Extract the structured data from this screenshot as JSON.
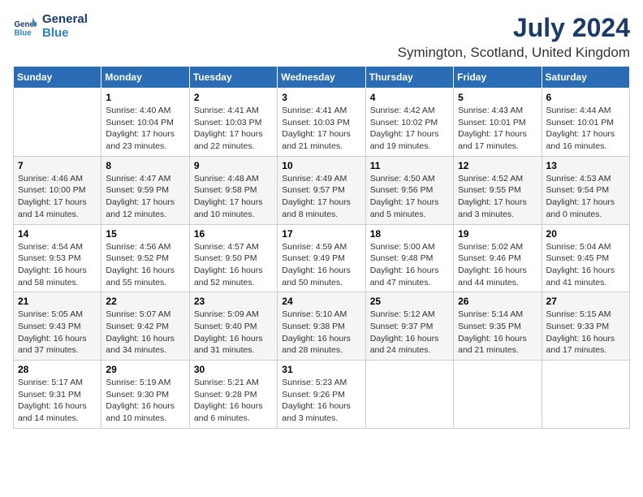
{
  "header": {
    "logo_line1": "General",
    "logo_line2": "Blue",
    "title": "July 2024",
    "subtitle": "Symington, Scotland, United Kingdom"
  },
  "calendar": {
    "days_of_week": [
      "Sunday",
      "Monday",
      "Tuesday",
      "Wednesday",
      "Thursday",
      "Friday",
      "Saturday"
    ],
    "weeks": [
      [
        {
          "day": "",
          "info": ""
        },
        {
          "day": "1",
          "info": "Sunrise: 4:40 AM\nSunset: 10:04 PM\nDaylight: 17 hours\nand 23 minutes."
        },
        {
          "day": "2",
          "info": "Sunrise: 4:41 AM\nSunset: 10:03 PM\nDaylight: 17 hours\nand 22 minutes."
        },
        {
          "day": "3",
          "info": "Sunrise: 4:41 AM\nSunset: 10:03 PM\nDaylight: 17 hours\nand 21 minutes."
        },
        {
          "day": "4",
          "info": "Sunrise: 4:42 AM\nSunset: 10:02 PM\nDaylight: 17 hours\nand 19 minutes."
        },
        {
          "day": "5",
          "info": "Sunrise: 4:43 AM\nSunset: 10:01 PM\nDaylight: 17 hours\nand 17 minutes."
        },
        {
          "day": "6",
          "info": "Sunrise: 4:44 AM\nSunset: 10:01 PM\nDaylight: 17 hours\nand 16 minutes."
        }
      ],
      [
        {
          "day": "7",
          "info": "Sunrise: 4:46 AM\nSunset: 10:00 PM\nDaylight: 17 hours\nand 14 minutes."
        },
        {
          "day": "8",
          "info": "Sunrise: 4:47 AM\nSunset: 9:59 PM\nDaylight: 17 hours\nand 12 minutes."
        },
        {
          "day": "9",
          "info": "Sunrise: 4:48 AM\nSunset: 9:58 PM\nDaylight: 17 hours\nand 10 minutes."
        },
        {
          "day": "10",
          "info": "Sunrise: 4:49 AM\nSunset: 9:57 PM\nDaylight: 17 hours\nand 8 minutes."
        },
        {
          "day": "11",
          "info": "Sunrise: 4:50 AM\nSunset: 9:56 PM\nDaylight: 17 hours\nand 5 minutes."
        },
        {
          "day": "12",
          "info": "Sunrise: 4:52 AM\nSunset: 9:55 PM\nDaylight: 17 hours\nand 3 minutes."
        },
        {
          "day": "13",
          "info": "Sunrise: 4:53 AM\nSunset: 9:54 PM\nDaylight: 17 hours\nand 0 minutes."
        }
      ],
      [
        {
          "day": "14",
          "info": "Sunrise: 4:54 AM\nSunset: 9:53 PM\nDaylight: 16 hours\nand 58 minutes."
        },
        {
          "day": "15",
          "info": "Sunrise: 4:56 AM\nSunset: 9:52 PM\nDaylight: 16 hours\nand 55 minutes."
        },
        {
          "day": "16",
          "info": "Sunrise: 4:57 AM\nSunset: 9:50 PM\nDaylight: 16 hours\nand 52 minutes."
        },
        {
          "day": "17",
          "info": "Sunrise: 4:59 AM\nSunset: 9:49 PM\nDaylight: 16 hours\nand 50 minutes."
        },
        {
          "day": "18",
          "info": "Sunrise: 5:00 AM\nSunset: 9:48 PM\nDaylight: 16 hours\nand 47 minutes."
        },
        {
          "day": "19",
          "info": "Sunrise: 5:02 AM\nSunset: 9:46 PM\nDaylight: 16 hours\nand 44 minutes."
        },
        {
          "day": "20",
          "info": "Sunrise: 5:04 AM\nSunset: 9:45 PM\nDaylight: 16 hours\nand 41 minutes."
        }
      ],
      [
        {
          "day": "21",
          "info": "Sunrise: 5:05 AM\nSunset: 9:43 PM\nDaylight: 16 hours\nand 37 minutes."
        },
        {
          "day": "22",
          "info": "Sunrise: 5:07 AM\nSunset: 9:42 PM\nDaylight: 16 hours\nand 34 minutes."
        },
        {
          "day": "23",
          "info": "Sunrise: 5:09 AM\nSunset: 9:40 PM\nDaylight: 16 hours\nand 31 minutes."
        },
        {
          "day": "24",
          "info": "Sunrise: 5:10 AM\nSunset: 9:38 PM\nDaylight: 16 hours\nand 28 minutes."
        },
        {
          "day": "25",
          "info": "Sunrise: 5:12 AM\nSunset: 9:37 PM\nDaylight: 16 hours\nand 24 minutes."
        },
        {
          "day": "26",
          "info": "Sunrise: 5:14 AM\nSunset: 9:35 PM\nDaylight: 16 hours\nand 21 minutes."
        },
        {
          "day": "27",
          "info": "Sunrise: 5:15 AM\nSunset: 9:33 PM\nDaylight: 16 hours\nand 17 minutes."
        }
      ],
      [
        {
          "day": "28",
          "info": "Sunrise: 5:17 AM\nSunset: 9:31 PM\nDaylight: 16 hours\nand 14 minutes."
        },
        {
          "day": "29",
          "info": "Sunrise: 5:19 AM\nSunset: 9:30 PM\nDaylight: 16 hours\nand 10 minutes."
        },
        {
          "day": "30",
          "info": "Sunrise: 5:21 AM\nSunset: 9:28 PM\nDaylight: 16 hours\nand 6 minutes."
        },
        {
          "day": "31",
          "info": "Sunrise: 5:23 AM\nSunset: 9:26 PM\nDaylight: 16 hours\nand 3 minutes."
        },
        {
          "day": "",
          "info": ""
        },
        {
          "day": "",
          "info": ""
        },
        {
          "day": "",
          "info": ""
        }
      ]
    ]
  }
}
